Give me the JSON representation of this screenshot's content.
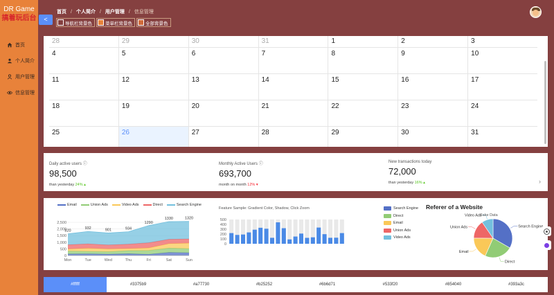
{
  "sidebar": {
    "brand_line1": "DR Game",
    "brand_line2": "搞着玩后台",
    "items": [
      {
        "label": "首页",
        "icon": "home-icon"
      },
      {
        "label": "个人简介",
        "icon": "user-icon"
      },
      {
        "label": "用户管理",
        "icon": "user-manage-icon"
      },
      {
        "label": "信息管理",
        "icon": "eye-icon"
      }
    ]
  },
  "header": {
    "collapse_label": "<",
    "breadcrumb": [
      "首页",
      "个人简介",
      "用户管理",
      "信息管理"
    ],
    "bg_toggles": [
      {
        "label": "导航栏背景色",
        "color": "#854040"
      },
      {
        "label": "菜单栏背景色",
        "color": "#e8823a"
      },
      {
        "label": "全部背景色",
        "color": "#d06a3a"
      }
    ]
  },
  "calendar": {
    "rows": [
      [
        "28",
        "29",
        "30",
        "31",
        "1",
        "2",
        "3"
      ],
      [
        "4",
        "5",
        "6",
        "7",
        "8",
        "9",
        "10"
      ],
      [
        "11",
        "12",
        "13",
        "14",
        "15",
        "16",
        "17"
      ],
      [
        "18",
        "19",
        "20",
        "21",
        "22",
        "23",
        "24"
      ],
      [
        "25",
        "26",
        "27",
        "28",
        "29",
        "30",
        "31"
      ]
    ],
    "other_month_first_row": 4,
    "today": "26"
  },
  "stats": [
    {
      "label": "Daily active users",
      "value": "98,500",
      "sub": "than yesterday",
      "change": "24%",
      "dir": "up"
    },
    {
      "label": "Monthly Active Users",
      "value": "693,700",
      "sub": "month on month",
      "change": "12%",
      "dir": "down"
    },
    {
      "label": "New transactions today",
      "value": "72,000",
      "sub": "than yesterday",
      "change": "16%",
      "dir": "up"
    }
  ],
  "chart_data": [
    {
      "type": "area",
      "categories": [
        "Mon",
        "Tue",
        "Wed",
        "Thu",
        "Fri",
        "Sat",
        "Sun"
      ],
      "ylim": [
        0,
        2500
      ],
      "yticks": [
        "2,500",
        "2,000",
        "1,500",
        "1,000",
        "500",
        "0"
      ],
      "series": [
        {
          "name": "Email",
          "color": "#5470c6",
          "values": [
            120,
            132,
            101,
            134,
            90,
            230,
            210
          ]
        },
        {
          "name": "Union Ads",
          "color": "#91cc75",
          "values": [
            220,
            182,
            191,
            234,
            290,
            330,
            310
          ]
        },
        {
          "name": "Video Ads",
          "color": "#fac858",
          "values": [
            150,
            232,
            201,
            154,
            190,
            330,
            410
          ]
        },
        {
          "name": "Direct",
          "color": "#ee6666",
          "values": [
            320,
            332,
            301,
            334,
            390,
            330,
            320
          ]
        },
        {
          "name": "Search Engine",
          "color": "#73c0de",
          "values": [
            820,
            932,
            901,
            934,
            1290,
            1330,
            1320
          ]
        }
      ],
      "labels": [
        "820",
        "932",
        "901",
        "934",
        "1290",
        "1330",
        "1320"
      ]
    },
    {
      "type": "bar",
      "title": "Feature Sample: Gradient Color, Shadow, Click Zoom",
      "ylim": [
        0,
        500
      ],
      "yticks": [
        "500",
        "400",
        "300",
        "200",
        "100",
        "0"
      ],
      "values": [
        220,
        182,
        191,
        234,
        290,
        330,
        310,
        123,
        442,
        321,
        90,
        149,
        210,
        122,
        133,
        334,
        198,
        123,
        125,
        220
      ]
    },
    {
      "type": "pie",
      "title": "Referer of a Website",
      "slices": [
        {
          "name": "Search Engine",
          "value": 1048,
          "color": "#5470c6"
        },
        {
          "name": "Direct",
          "value": 735,
          "color": "#91cc75"
        },
        {
          "name": "Email",
          "value": 580,
          "color": "#fac858"
        },
        {
          "name": "Union Ads",
          "value": 484,
          "color": "#ee6666"
        },
        {
          "name": "Video Ads",
          "value": 300,
          "color": "#73c0de"
        }
      ],
      "annotation": "Fake Data"
    }
  ],
  "palette": [
    {
      "label": "#ffffff",
      "active": true
    },
    {
      "label": "#3375b9",
      "active": false
    },
    {
      "label": "#a77730",
      "active": false
    },
    {
      "label": "#b25252",
      "active": false
    },
    {
      "label": "#6b6d71",
      "active": false
    },
    {
      "label": "#533f20",
      "active": false
    },
    {
      "label": "#854040",
      "active": false
    },
    {
      "label": "#393a3c",
      "active": false
    }
  ]
}
